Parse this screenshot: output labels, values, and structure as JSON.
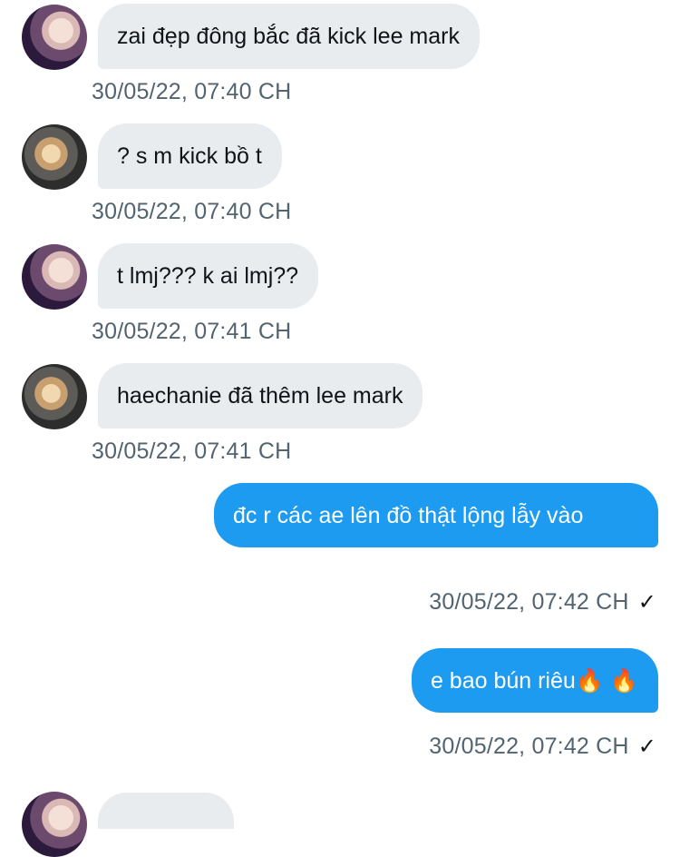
{
  "messages": [
    {
      "direction": "in",
      "avatar": "avatar-a",
      "text": "zai đẹp đông bắc đã kick lee mark",
      "timestamp": "30/05/22, 07:40 CH"
    },
    {
      "direction": "in",
      "avatar": "avatar-b",
      "text": "? s m kick bồ t",
      "timestamp": "30/05/22, 07:40 CH"
    },
    {
      "direction": "in",
      "avatar": "avatar-a",
      "text": "t lmj??? k ai lmj??",
      "timestamp": "30/05/22, 07:41 CH"
    },
    {
      "direction": "in",
      "avatar": "avatar-b",
      "text": "haechanie đã thêm lee mark",
      "timestamp": "30/05/22, 07:41 CH"
    },
    {
      "direction": "out",
      "text": "đc r các ae lên đồ thật lộng lẫy vào",
      "timestamp": "30/05/22, 07:42 CH",
      "status": "✓"
    },
    {
      "direction": "out",
      "text": "e bao bún riêu🔥 🔥",
      "timestamp": "30/05/22, 07:42 CH",
      "status": "✓"
    }
  ],
  "colors": {
    "incoming_bubble": "#e8ecef",
    "outgoing_bubble": "#1d9bf0",
    "timestamp": "#536471",
    "text": "#0f1419"
  },
  "icons": [
    "avatar-photo",
    "fire-emoji",
    "sent-check-icon"
  ]
}
